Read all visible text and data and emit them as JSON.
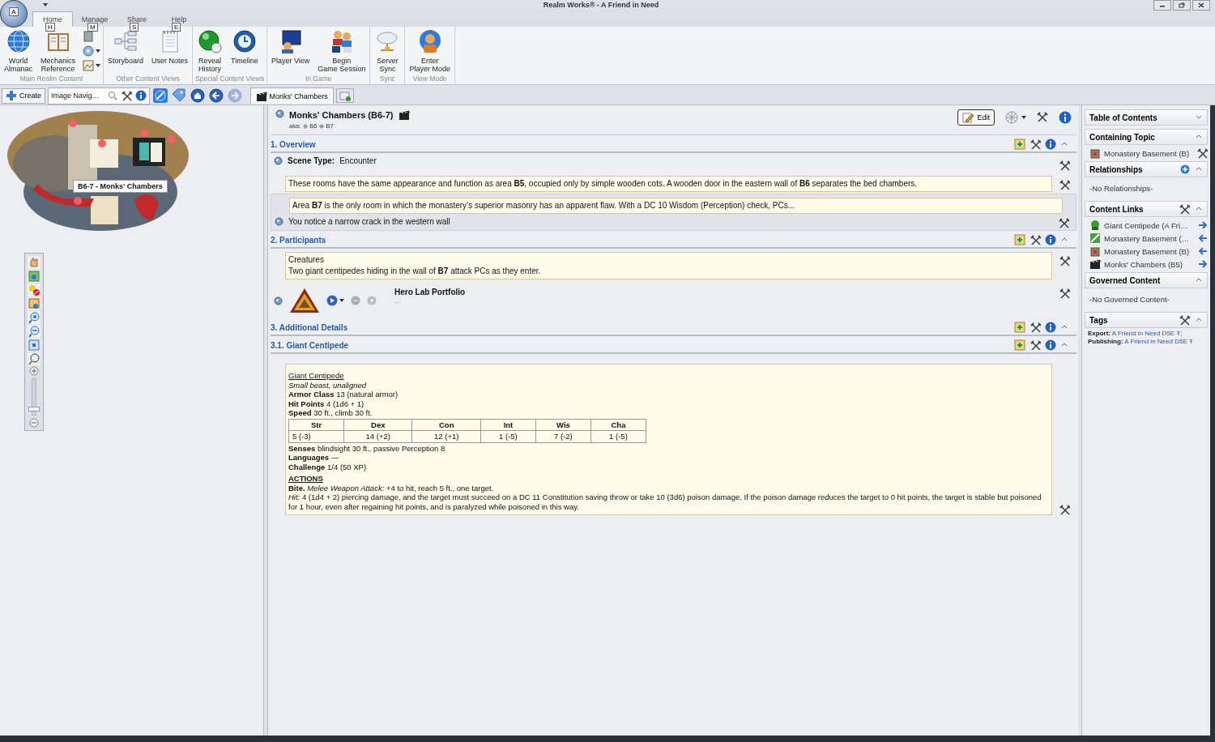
{
  "window": {
    "title": "Realm Works® - A Friend in Need",
    "app_keytip": "A"
  },
  "ribbon": {
    "tabs": [
      {
        "label": "Home",
        "keytip": "H",
        "selected": true
      },
      {
        "label": "Manage",
        "keytip": "M",
        "selected": false
      },
      {
        "label": "Share",
        "keytip": "S",
        "selected": false
      },
      {
        "label": "Help",
        "keytip": "E",
        "selected": false
      }
    ],
    "groups": [
      {
        "label": "Main Realm Content",
        "buttons": [
          {
            "lines": [
              "World",
              "Almanac"
            ]
          },
          {
            "lines": [
              "Mechanics",
              "Reference"
            ]
          }
        ],
        "small": [
          {
            "dropdown": false
          },
          {
            "dropdown": true
          },
          {
            "dropdown": true
          }
        ]
      },
      {
        "label": "Other Content Views",
        "buttons": [
          {
            "lines": [
              "Storyboard"
            ]
          },
          {
            "lines": [
              "User Notes"
            ]
          }
        ]
      },
      {
        "label": "Special Content Views",
        "buttons": [
          {
            "lines": [
              "Reveal",
              "History"
            ]
          },
          {
            "lines": [
              "Timeline"
            ]
          }
        ]
      },
      {
        "label": "In Game",
        "buttons": [
          {
            "lines": [
              "Player View"
            ]
          },
          {
            "lines": [
              "Begin",
              "Game Session"
            ]
          }
        ]
      },
      {
        "label": "Sync",
        "buttons": [
          {
            "lines": [
              "Server",
              "Sync"
            ]
          }
        ]
      },
      {
        "label": "View Mode",
        "buttons": [
          {
            "lines": [
              "Enter",
              "Player Mode"
            ]
          }
        ]
      }
    ]
  },
  "toolbar": {
    "create": "Create",
    "panel_tab": "Image Navig…",
    "nav": [
      {
        "disabled": false
      },
      {
        "disabled": false
      },
      {
        "disabled": false
      },
      {
        "disabled": false
      },
      {
        "disabled": true
      }
    ],
    "tabs": [
      {
        "label": "Monks' Chambers",
        "selected": true
      }
    ]
  },
  "map": {
    "label": "B6-7 - Monks' Chambers",
    "zoom": {
      "level": 0.1
    }
  },
  "article": {
    "title": "Monks' Chambers (B6-7)",
    "aka_label": "aka:",
    "aliases": [
      "B6",
      "B7"
    ],
    "edit": "Edit",
    "sections": [
      {
        "title": "1. Overview",
        "snippets": [
          {
            "kind": "field",
            "label": "Scene Type:",
            "value": "Encounter"
          },
          {
            "kind": "text",
            "lines": [
              "These rooms have the same appearance and function as area **B5**, occupied only by simple wooden cots. A wooden door in the eastern wall of **B6** separates the bed chambers."
            ]
          },
          {
            "kind": "text",
            "lines": [
              "Area **B7** is the only room in which the monastery’s superior masonry has an apparent flaw. With a DC 10 Wisdom (Perception) check, PCs..."
            ],
            "annotation": "You notice a narrow crack in the western wall"
          }
        ]
      },
      {
        "title": "2. Participants",
        "snippets": [
          {
            "kind": "text",
            "lines": [
              "Creatures",
              "Two giant centipedes hiding in the wall of **B7** attack PCs as they enter."
            ]
          },
          {
            "kind": "portfolio",
            "title": "Hero Lab Portfolio",
            "subtitle": "..."
          }
        ]
      },
      {
        "title": "3. Additional Details"
      },
      {
        "title": "3.1. Giant Centipede",
        "snippets": [
          {
            "kind": "statblock",
            "name": "Giant Centipede",
            "type": "Small beast, unaligned",
            "props": [
              "**Armor Class** 13 (natural armor)",
              "**Hit Points** 4 (1d6 + 1)",
              "**Speed** 30 ft., climb 30 ft."
            ],
            "table": {
              "columns": [
                "Str",
                "Dex",
                "Con",
                "Int",
                "Wis",
                "Cha"
              ],
              "values": [
                "5 (-3)",
                "14 (+2)",
                "12 (+1)",
                "1 (-5)",
                "7 (-2)",
                "1 (-5)"
              ]
            },
            "props2": [
              "**Senses** blindsight 30 ft., passive Perception 8",
              "**Languages** —",
              "**Challenge** 1/4 (50 XP)"
            ],
            "actions_heading": "ACTIONS",
            "actions": [
              "**Bite.** *Melee Weapon Attack:* +4 to hit, reach 5 ft., one target.",
              "*Hit:* 4 (1d4 + 2) piercing damage, and the target must succeed on a DC 11 Constitution saving throw or take 10 (3d6) poison damage. If the poison damage reduces the target to 0 hit points, the target is stable but poisoned for 1 hour, even after regaining hit points, and is paralyzed while poisoned in this way."
            ]
          }
        ]
      }
    ]
  },
  "sidebar": [
    {
      "title": "Table of Contents",
      "kind": "plain",
      "expanded": false
    },
    {
      "title": "Containing Topic",
      "kind": "plain",
      "expanded": true,
      "items": [
        {
          "label": "Monastery Basement (B)",
          "kind": "parent"
        }
      ]
    },
    {
      "title": "Relationships",
      "kind": "adder",
      "expanded": true,
      "empty": "-No Relationships-"
    },
    {
      "title": "Content Links",
      "kind": "tooled",
      "expanded": true,
      "items": [
        {
          "label": "Giant Centipede (A Fri…",
          "kind": "outbound"
        },
        {
          "label": "Monastery Basement (…",
          "kind": "inbound"
        },
        {
          "label": "Monastery Basement (B)",
          "kind": "inbound"
        },
        {
          "label": "Monks' Chambers (B5)",
          "kind": "outbound"
        }
      ]
    },
    {
      "title": "Governed Content",
      "kind": "plain",
      "expanded": true,
      "empty": "-No Governed Content-"
    },
    {
      "title": "Tags",
      "kind": "tooled",
      "expanded": true,
      "tags": [
        {
          "label": "Export:",
          "value": "A Friend in Need D5E Ŧ;"
        },
        {
          "label": "Publishing:",
          "value": "A Friend in Need D5E Ŧ"
        }
      ]
    }
  ]
}
